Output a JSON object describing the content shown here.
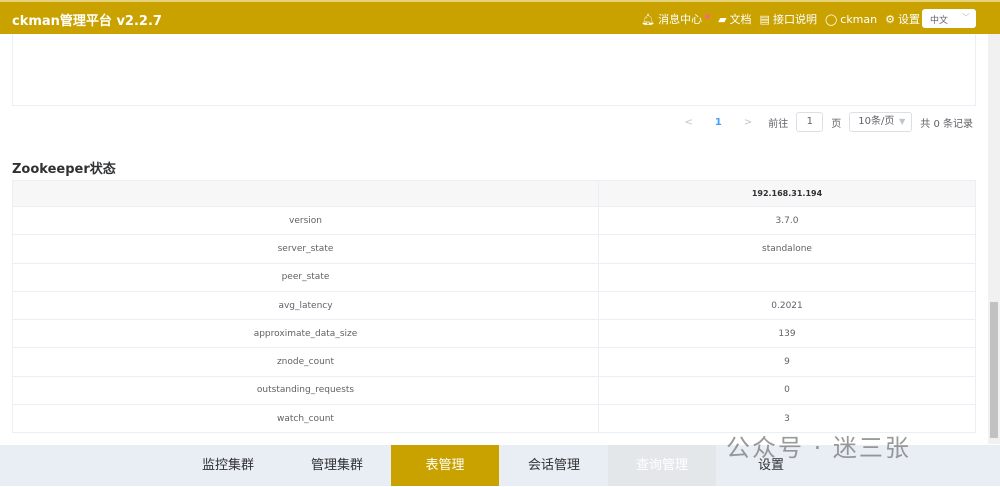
{
  "header": {
    "title": "ckman管理平台 v2.2.7",
    "nav": {
      "messages": "消息中心",
      "docs": "文档",
      "api": "接口说明",
      "user": "ckman",
      "settings": "设置"
    },
    "language": "中文"
  },
  "pagination": {
    "current": "1",
    "goto_prefix": "前往",
    "goto_value": "1",
    "goto_suffix": "页",
    "page_size": "10条/页",
    "total": "共 0 条记录"
  },
  "zookeeper": {
    "title": "Zookeeper状态",
    "host": "192.168.31.194",
    "rows": [
      {
        "key": "version",
        "value": "3.7.0"
      },
      {
        "key": "server_state",
        "value": "standalone"
      },
      {
        "key": "peer_state",
        "value": ""
      },
      {
        "key": "avg_latency",
        "value": "0.2021"
      },
      {
        "key": "approximate_data_size",
        "value": "139"
      },
      {
        "key": "znode_count",
        "value": "9"
      },
      {
        "key": "outstanding_requests",
        "value": "0"
      },
      {
        "key": "watch_count",
        "value": "3"
      }
    ]
  },
  "bottom_tabs": [
    "监控集群",
    "管理集群",
    "表管理",
    "会话管理",
    "查询管理",
    "设置"
  ],
  "watermark": "公众号 · 迷三张",
  "colors": {
    "brand": "#c9a200",
    "link": "#409eff"
  }
}
